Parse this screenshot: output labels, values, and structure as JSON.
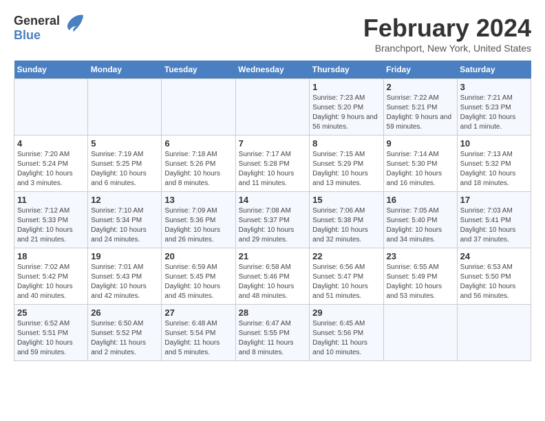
{
  "header": {
    "logo_general": "General",
    "logo_blue": "Blue",
    "month_title": "February 2024",
    "location": "Branchport, New York, United States"
  },
  "columns": [
    "Sunday",
    "Monday",
    "Tuesday",
    "Wednesday",
    "Thursday",
    "Friday",
    "Saturday"
  ],
  "weeks": [
    [
      {
        "day": "",
        "sunrise": "",
        "sunset": "",
        "daylight": ""
      },
      {
        "day": "",
        "sunrise": "",
        "sunset": "",
        "daylight": ""
      },
      {
        "day": "",
        "sunrise": "",
        "sunset": "",
        "daylight": ""
      },
      {
        "day": "",
        "sunrise": "",
        "sunset": "",
        "daylight": ""
      },
      {
        "day": "1",
        "sunrise": "Sunrise: 7:23 AM",
        "sunset": "Sunset: 5:20 PM",
        "daylight": "Daylight: 9 hours and 56 minutes."
      },
      {
        "day": "2",
        "sunrise": "Sunrise: 7:22 AM",
        "sunset": "Sunset: 5:21 PM",
        "daylight": "Daylight: 9 hours and 59 minutes."
      },
      {
        "day": "3",
        "sunrise": "Sunrise: 7:21 AM",
        "sunset": "Sunset: 5:23 PM",
        "daylight": "Daylight: 10 hours and 1 minute."
      }
    ],
    [
      {
        "day": "4",
        "sunrise": "Sunrise: 7:20 AM",
        "sunset": "Sunset: 5:24 PM",
        "daylight": "Daylight: 10 hours and 3 minutes."
      },
      {
        "day": "5",
        "sunrise": "Sunrise: 7:19 AM",
        "sunset": "Sunset: 5:25 PM",
        "daylight": "Daylight: 10 hours and 6 minutes."
      },
      {
        "day": "6",
        "sunrise": "Sunrise: 7:18 AM",
        "sunset": "Sunset: 5:26 PM",
        "daylight": "Daylight: 10 hours and 8 minutes."
      },
      {
        "day": "7",
        "sunrise": "Sunrise: 7:17 AM",
        "sunset": "Sunset: 5:28 PM",
        "daylight": "Daylight: 10 hours and 11 minutes."
      },
      {
        "day": "8",
        "sunrise": "Sunrise: 7:15 AM",
        "sunset": "Sunset: 5:29 PM",
        "daylight": "Daylight: 10 hours and 13 minutes."
      },
      {
        "day": "9",
        "sunrise": "Sunrise: 7:14 AM",
        "sunset": "Sunset: 5:30 PM",
        "daylight": "Daylight: 10 hours and 16 minutes."
      },
      {
        "day": "10",
        "sunrise": "Sunrise: 7:13 AM",
        "sunset": "Sunset: 5:32 PM",
        "daylight": "Daylight: 10 hours and 18 minutes."
      }
    ],
    [
      {
        "day": "11",
        "sunrise": "Sunrise: 7:12 AM",
        "sunset": "Sunset: 5:33 PM",
        "daylight": "Daylight: 10 hours and 21 minutes."
      },
      {
        "day": "12",
        "sunrise": "Sunrise: 7:10 AM",
        "sunset": "Sunset: 5:34 PM",
        "daylight": "Daylight: 10 hours and 24 minutes."
      },
      {
        "day": "13",
        "sunrise": "Sunrise: 7:09 AM",
        "sunset": "Sunset: 5:36 PM",
        "daylight": "Daylight: 10 hours and 26 minutes."
      },
      {
        "day": "14",
        "sunrise": "Sunrise: 7:08 AM",
        "sunset": "Sunset: 5:37 PM",
        "daylight": "Daylight: 10 hours and 29 minutes."
      },
      {
        "day": "15",
        "sunrise": "Sunrise: 7:06 AM",
        "sunset": "Sunset: 5:38 PM",
        "daylight": "Daylight: 10 hours and 32 minutes."
      },
      {
        "day": "16",
        "sunrise": "Sunrise: 7:05 AM",
        "sunset": "Sunset: 5:40 PM",
        "daylight": "Daylight: 10 hours and 34 minutes."
      },
      {
        "day": "17",
        "sunrise": "Sunrise: 7:03 AM",
        "sunset": "Sunset: 5:41 PM",
        "daylight": "Daylight: 10 hours and 37 minutes."
      }
    ],
    [
      {
        "day": "18",
        "sunrise": "Sunrise: 7:02 AM",
        "sunset": "Sunset: 5:42 PM",
        "daylight": "Daylight: 10 hours and 40 minutes."
      },
      {
        "day": "19",
        "sunrise": "Sunrise: 7:01 AM",
        "sunset": "Sunset: 5:43 PM",
        "daylight": "Daylight: 10 hours and 42 minutes."
      },
      {
        "day": "20",
        "sunrise": "Sunrise: 6:59 AM",
        "sunset": "Sunset: 5:45 PM",
        "daylight": "Daylight: 10 hours and 45 minutes."
      },
      {
        "day": "21",
        "sunrise": "Sunrise: 6:58 AM",
        "sunset": "Sunset: 5:46 PM",
        "daylight": "Daylight: 10 hours and 48 minutes."
      },
      {
        "day": "22",
        "sunrise": "Sunrise: 6:56 AM",
        "sunset": "Sunset: 5:47 PM",
        "daylight": "Daylight: 10 hours and 51 minutes."
      },
      {
        "day": "23",
        "sunrise": "Sunrise: 6:55 AM",
        "sunset": "Sunset: 5:49 PM",
        "daylight": "Daylight: 10 hours and 53 minutes."
      },
      {
        "day": "24",
        "sunrise": "Sunrise: 6:53 AM",
        "sunset": "Sunset: 5:50 PM",
        "daylight": "Daylight: 10 hours and 56 minutes."
      }
    ],
    [
      {
        "day": "25",
        "sunrise": "Sunrise: 6:52 AM",
        "sunset": "Sunset: 5:51 PM",
        "daylight": "Daylight: 10 hours and 59 minutes."
      },
      {
        "day": "26",
        "sunrise": "Sunrise: 6:50 AM",
        "sunset": "Sunset: 5:52 PM",
        "daylight": "Daylight: 11 hours and 2 minutes."
      },
      {
        "day": "27",
        "sunrise": "Sunrise: 6:48 AM",
        "sunset": "Sunset: 5:54 PM",
        "daylight": "Daylight: 11 hours and 5 minutes."
      },
      {
        "day": "28",
        "sunrise": "Sunrise: 6:47 AM",
        "sunset": "Sunset: 5:55 PM",
        "daylight": "Daylight: 11 hours and 8 minutes."
      },
      {
        "day": "29",
        "sunrise": "Sunrise: 6:45 AM",
        "sunset": "Sunset: 5:56 PM",
        "daylight": "Daylight: 11 hours and 10 minutes."
      },
      {
        "day": "",
        "sunrise": "",
        "sunset": "",
        "daylight": ""
      },
      {
        "day": "",
        "sunrise": "",
        "sunset": "",
        "daylight": ""
      }
    ]
  ]
}
